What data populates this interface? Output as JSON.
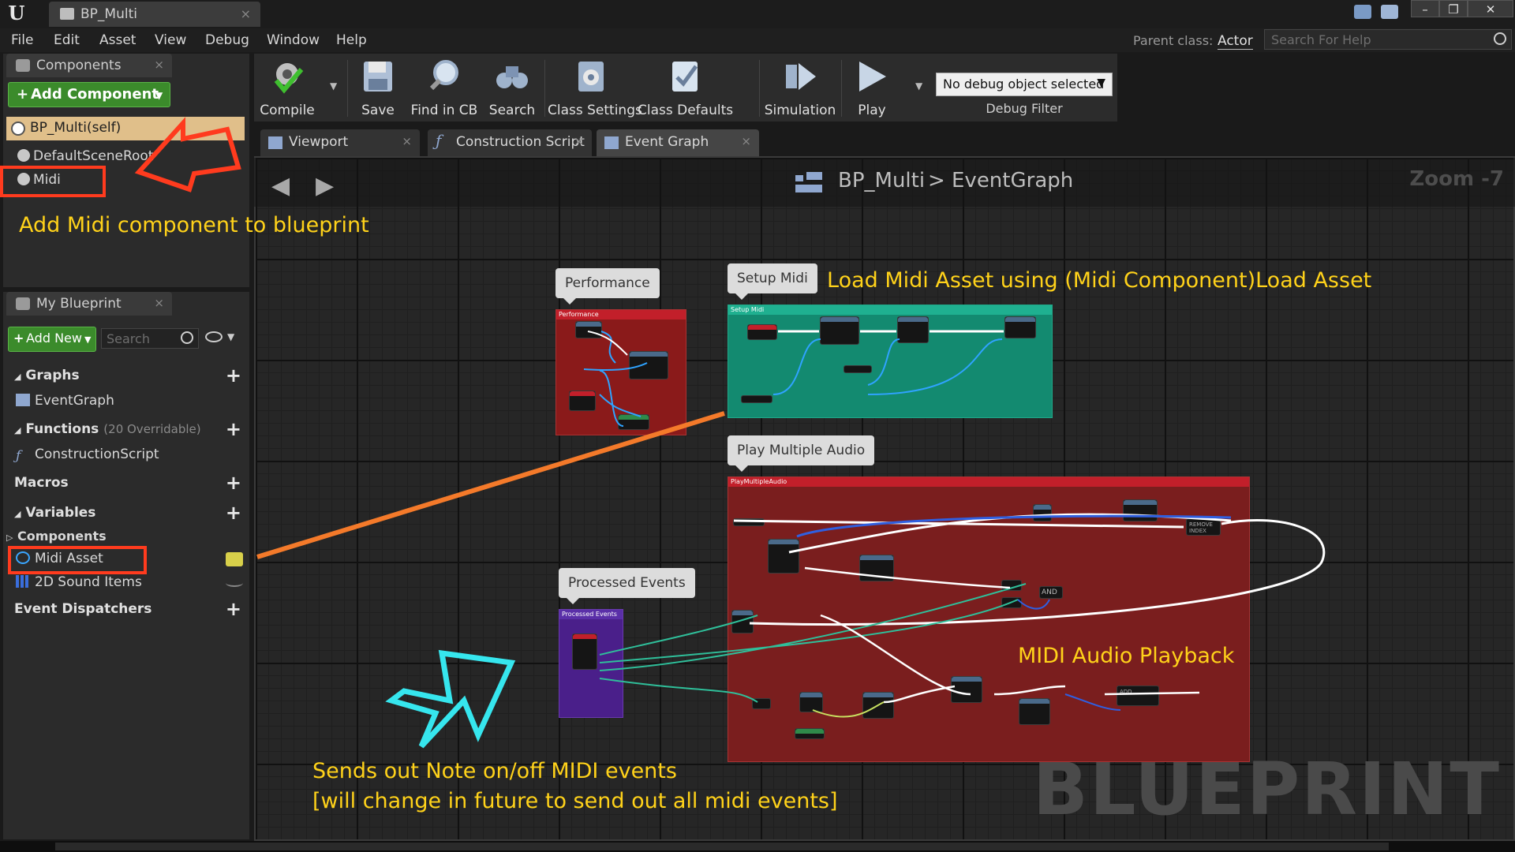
{
  "window": {
    "tab_title": "BP_Multi",
    "close_glyph": "×"
  },
  "menu": {
    "items": [
      "File",
      "Edit",
      "Asset",
      "View",
      "Debug",
      "Window",
      "Help"
    ],
    "parent_class_label": "Parent class:",
    "parent_class_value": "Actor",
    "help_search_placeholder": "Search For Help"
  },
  "components_panel": {
    "tab_label": "Components",
    "add_button": "Add Component",
    "self_item": "BP_Multi(self)",
    "items": [
      "DefaultSceneRoot",
      "Midi"
    ]
  },
  "my_blueprint_panel": {
    "tab_label": "My Blueprint",
    "add_button": "Add New",
    "search_placeholder": "Search",
    "sections": {
      "graphs": "Graphs",
      "graphs_item": "EventGraph",
      "functions": "Functions",
      "functions_sub": "(20 Overridable)",
      "functions_item": "ConstructionScript",
      "macros": "Macros",
      "variables": "Variables",
      "components": "Components",
      "variable_items": [
        "Midi Asset",
        "2D Sound Items"
      ],
      "event_dispatchers": "Event Dispatchers"
    }
  },
  "toolbar": {
    "tools": [
      "Compile",
      "Save",
      "Find in CB",
      "Search",
      "Class Settings",
      "Class Defaults",
      "Simulation",
      "Play"
    ],
    "debug_select": "No debug object selected",
    "debug_filter": "Debug Filter"
  },
  "editor_tabs": [
    "Viewport",
    "Construction Script",
    "Event Graph"
  ],
  "graph": {
    "breadcrumb_name": "BP_Multi",
    "breadcrumb_sep": ">",
    "breadcrumb_graph": "EventGraph",
    "zoom": "Zoom -7",
    "watermark": "BLUEPRINT",
    "comments": {
      "performance": "Performance",
      "setup_midi": "Setup Midi",
      "play_multiple_audio": "Play Multiple Audio",
      "processed_events": "Processed Events"
    },
    "comment_headers": {
      "performance": "Performance",
      "setup_midi": "Setup Midi",
      "play_multiple_audio": "PlayMultipleAudio",
      "processed_events": "Processed Events"
    },
    "node_labels": {
      "and": "AND",
      "remove_index": "REMOVE INDEX",
      "add": "ADD"
    }
  },
  "annotations": {
    "add_midi": "Add Midi component to blueprint",
    "load_midi": "Load Midi Asset using (Midi Component)Load Asset",
    "midi_playback": "MIDI Audio Playback",
    "sends_line1": "Sends out Note on/off MIDI events",
    "sends_line2": "[will change in future to send out all midi events]"
  },
  "colors": {
    "annotation_text": "#ffd21a",
    "highlight_box": "#ff3b1e",
    "arrow_orange": "#f47a2a",
    "arrow_cyan": "#36e6ee",
    "performance_comment": "#8a1a1a",
    "setup_comment": "#138a70",
    "play_audio_comment": "#7a1e1e",
    "processed_comment": "#4a1f8a"
  }
}
